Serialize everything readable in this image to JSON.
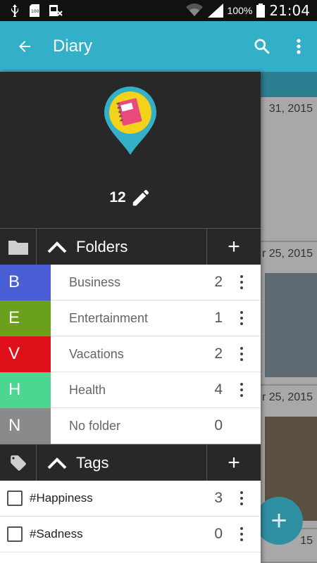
{
  "status_bar": {
    "battery_percent": "100%",
    "time": "21:04"
  },
  "appbar": {
    "title": "Diary",
    "color": "#33b0c8"
  },
  "drawer": {
    "entry_count": "12",
    "folders_section": {
      "title": "Folders",
      "add_label": "+"
    },
    "folders": [
      {
        "letter": "B",
        "name": "Business",
        "count": "2",
        "color": "#4a5fd6"
      },
      {
        "letter": "E",
        "name": "Entertainment",
        "count": "1",
        "color": "#6aa01c"
      },
      {
        "letter": "V",
        "name": "Vacations",
        "count": "2",
        "color": "#e0101a"
      },
      {
        "letter": "H",
        "name": "Health",
        "count": "4",
        "color": "#4cd690"
      },
      {
        "letter": "N",
        "name": "No folder",
        "count": "0",
        "color": "#8a8a8a"
      }
    ],
    "tags_section": {
      "title": "Tags",
      "add_label": "+"
    },
    "tags": [
      {
        "name": "#Happiness",
        "count": "3"
      },
      {
        "name": "#Sadness",
        "count": "0"
      }
    ]
  },
  "background_list": {
    "dates": [
      "31, 2015",
      "r 25, 2015",
      "r 25, 2015",
      "15"
    ]
  },
  "fab": {
    "label": "+"
  }
}
